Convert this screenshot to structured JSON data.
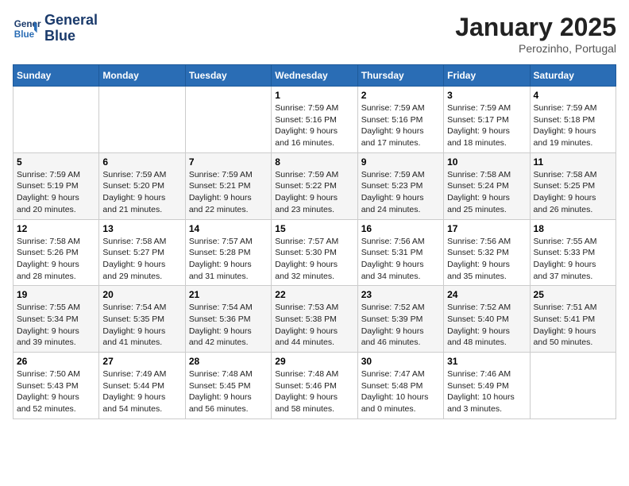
{
  "header": {
    "logo_line1": "General",
    "logo_line2": "Blue",
    "month": "January 2025",
    "location": "Perozinho, Portugal"
  },
  "weekdays": [
    "Sunday",
    "Monday",
    "Tuesday",
    "Wednesday",
    "Thursday",
    "Friday",
    "Saturday"
  ],
  "weeks": [
    [
      {
        "day": "",
        "info": ""
      },
      {
        "day": "",
        "info": ""
      },
      {
        "day": "",
        "info": ""
      },
      {
        "day": "1",
        "info": "Sunrise: 7:59 AM\nSunset: 5:16 PM\nDaylight: 9 hours\nand 16 minutes."
      },
      {
        "day": "2",
        "info": "Sunrise: 7:59 AM\nSunset: 5:16 PM\nDaylight: 9 hours\nand 17 minutes."
      },
      {
        "day": "3",
        "info": "Sunrise: 7:59 AM\nSunset: 5:17 PM\nDaylight: 9 hours\nand 18 minutes."
      },
      {
        "day": "4",
        "info": "Sunrise: 7:59 AM\nSunset: 5:18 PM\nDaylight: 9 hours\nand 19 minutes."
      }
    ],
    [
      {
        "day": "5",
        "info": "Sunrise: 7:59 AM\nSunset: 5:19 PM\nDaylight: 9 hours\nand 20 minutes."
      },
      {
        "day": "6",
        "info": "Sunrise: 7:59 AM\nSunset: 5:20 PM\nDaylight: 9 hours\nand 21 minutes."
      },
      {
        "day": "7",
        "info": "Sunrise: 7:59 AM\nSunset: 5:21 PM\nDaylight: 9 hours\nand 22 minutes."
      },
      {
        "day": "8",
        "info": "Sunrise: 7:59 AM\nSunset: 5:22 PM\nDaylight: 9 hours\nand 23 minutes."
      },
      {
        "day": "9",
        "info": "Sunrise: 7:59 AM\nSunset: 5:23 PM\nDaylight: 9 hours\nand 24 minutes."
      },
      {
        "day": "10",
        "info": "Sunrise: 7:58 AM\nSunset: 5:24 PM\nDaylight: 9 hours\nand 25 minutes."
      },
      {
        "day": "11",
        "info": "Sunrise: 7:58 AM\nSunset: 5:25 PM\nDaylight: 9 hours\nand 26 minutes."
      }
    ],
    [
      {
        "day": "12",
        "info": "Sunrise: 7:58 AM\nSunset: 5:26 PM\nDaylight: 9 hours\nand 28 minutes."
      },
      {
        "day": "13",
        "info": "Sunrise: 7:58 AM\nSunset: 5:27 PM\nDaylight: 9 hours\nand 29 minutes."
      },
      {
        "day": "14",
        "info": "Sunrise: 7:57 AM\nSunset: 5:28 PM\nDaylight: 9 hours\nand 31 minutes."
      },
      {
        "day": "15",
        "info": "Sunrise: 7:57 AM\nSunset: 5:30 PM\nDaylight: 9 hours\nand 32 minutes."
      },
      {
        "day": "16",
        "info": "Sunrise: 7:56 AM\nSunset: 5:31 PM\nDaylight: 9 hours\nand 34 minutes."
      },
      {
        "day": "17",
        "info": "Sunrise: 7:56 AM\nSunset: 5:32 PM\nDaylight: 9 hours\nand 35 minutes."
      },
      {
        "day": "18",
        "info": "Sunrise: 7:55 AM\nSunset: 5:33 PM\nDaylight: 9 hours\nand 37 minutes."
      }
    ],
    [
      {
        "day": "19",
        "info": "Sunrise: 7:55 AM\nSunset: 5:34 PM\nDaylight: 9 hours\nand 39 minutes."
      },
      {
        "day": "20",
        "info": "Sunrise: 7:54 AM\nSunset: 5:35 PM\nDaylight: 9 hours\nand 41 minutes."
      },
      {
        "day": "21",
        "info": "Sunrise: 7:54 AM\nSunset: 5:36 PM\nDaylight: 9 hours\nand 42 minutes."
      },
      {
        "day": "22",
        "info": "Sunrise: 7:53 AM\nSunset: 5:38 PM\nDaylight: 9 hours\nand 44 minutes."
      },
      {
        "day": "23",
        "info": "Sunrise: 7:52 AM\nSunset: 5:39 PM\nDaylight: 9 hours\nand 46 minutes."
      },
      {
        "day": "24",
        "info": "Sunrise: 7:52 AM\nSunset: 5:40 PM\nDaylight: 9 hours\nand 48 minutes."
      },
      {
        "day": "25",
        "info": "Sunrise: 7:51 AM\nSunset: 5:41 PM\nDaylight: 9 hours\nand 50 minutes."
      }
    ],
    [
      {
        "day": "26",
        "info": "Sunrise: 7:50 AM\nSunset: 5:43 PM\nDaylight: 9 hours\nand 52 minutes."
      },
      {
        "day": "27",
        "info": "Sunrise: 7:49 AM\nSunset: 5:44 PM\nDaylight: 9 hours\nand 54 minutes."
      },
      {
        "day": "28",
        "info": "Sunrise: 7:48 AM\nSunset: 5:45 PM\nDaylight: 9 hours\nand 56 minutes."
      },
      {
        "day": "29",
        "info": "Sunrise: 7:48 AM\nSunset: 5:46 PM\nDaylight: 9 hours\nand 58 minutes."
      },
      {
        "day": "30",
        "info": "Sunrise: 7:47 AM\nSunset: 5:48 PM\nDaylight: 10 hours\nand 0 minutes."
      },
      {
        "day": "31",
        "info": "Sunrise: 7:46 AM\nSunset: 5:49 PM\nDaylight: 10 hours\nand 3 minutes."
      },
      {
        "day": "",
        "info": ""
      }
    ]
  ]
}
